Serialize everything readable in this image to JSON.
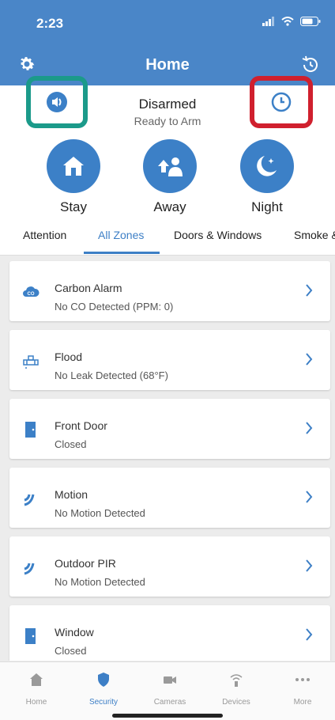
{
  "status_bar": {
    "time": "2:23"
  },
  "header": {
    "title": "Home"
  },
  "alarm": {
    "state": "Disarmed",
    "substate": "Ready to Arm"
  },
  "arm_buttons": [
    {
      "label": "Stay",
      "icon": "house-icon"
    },
    {
      "label": "Away",
      "icon": "people-icon"
    },
    {
      "label": "Night",
      "icon": "moon-icon"
    }
  ],
  "tabs": {
    "attention": "Attention",
    "all_zones": "All Zones",
    "doors_windows": "Doors & Windows",
    "smoke": "Smoke &"
  },
  "zones": [
    {
      "name": "Carbon Alarm",
      "status": "No CO Detected (PPM: 0)",
      "icon": "co-cloud-icon"
    },
    {
      "name": "Flood",
      "status": "No Leak Detected (68°F)",
      "icon": "pipe-icon"
    },
    {
      "name": "Front Door",
      "status": "Closed",
      "icon": "door-icon"
    },
    {
      "name": "Motion",
      "status": "No Motion Detected",
      "icon": "motion-icon"
    },
    {
      "name": "Outdoor PIR",
      "status": "No Motion Detected",
      "icon": "motion-icon"
    },
    {
      "name": "Window",
      "status": "Closed",
      "icon": "window-icon"
    }
  ],
  "bottom_nav": {
    "home": "Home",
    "security": "Security",
    "cameras": "Cameras",
    "devices": "Devices",
    "more": "More"
  },
  "colors": {
    "header": "#4a86c8",
    "accent": "#3d7fc6",
    "highlight_green": "#1b9a8a",
    "highlight_red": "#d0202e"
  }
}
